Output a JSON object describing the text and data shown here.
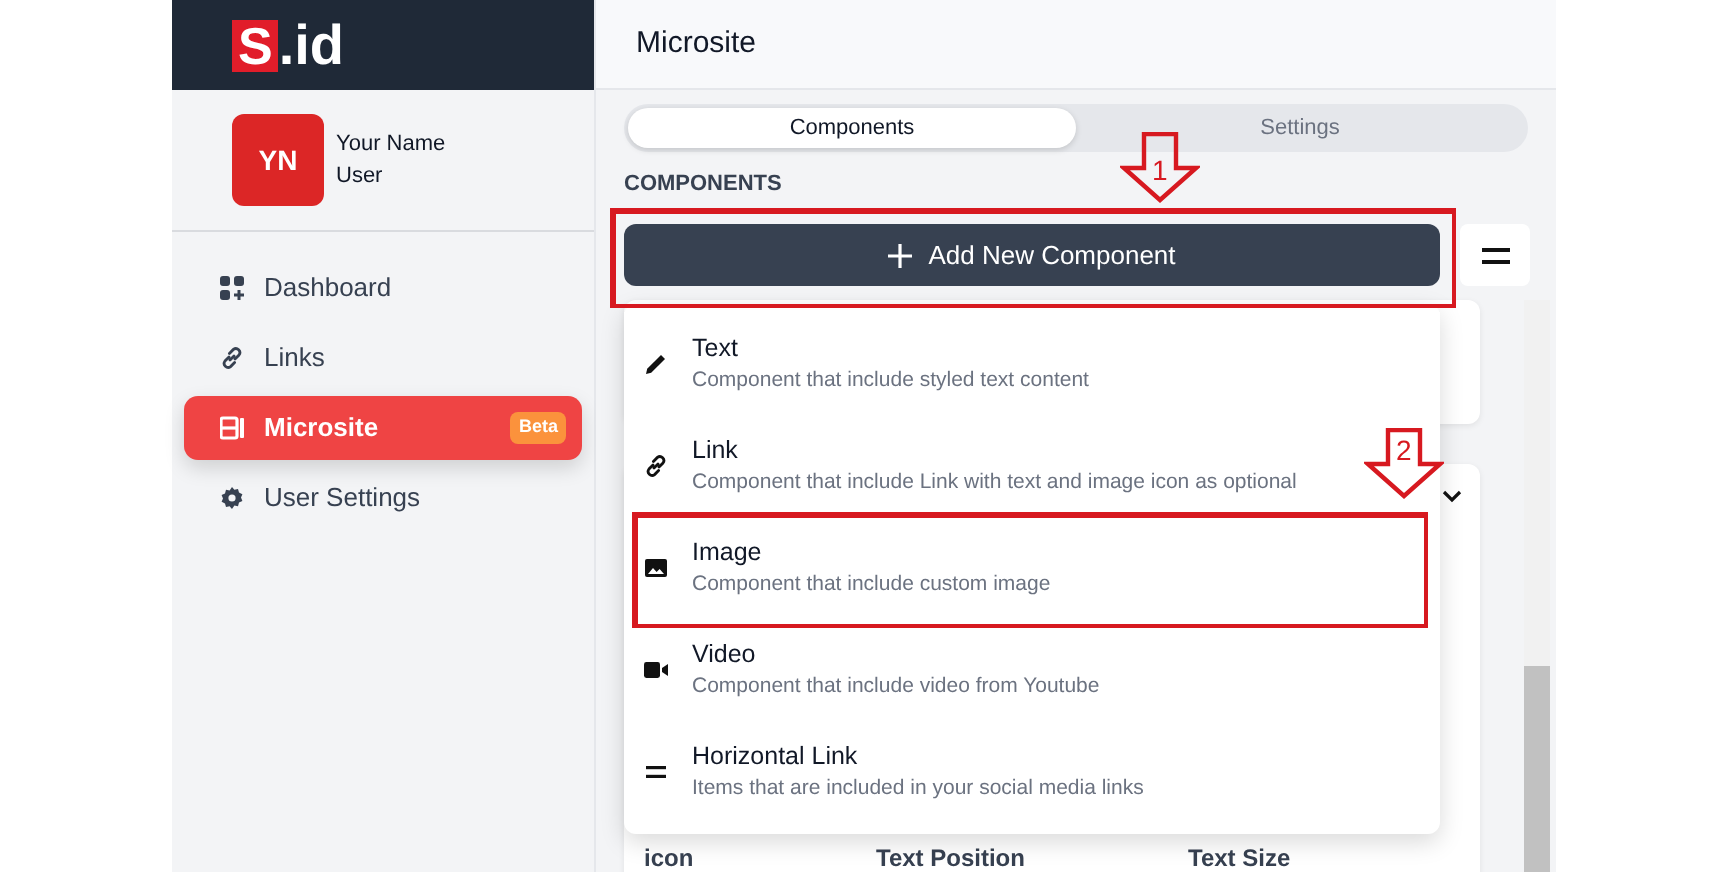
{
  "logo": {
    "mark": "S",
    "rest": ".id"
  },
  "user": {
    "initials": "YN",
    "name": "Your Name",
    "role": "User"
  },
  "nav": [
    {
      "kind": "dashboard",
      "label": "Dashboard",
      "selected": false
    },
    {
      "kind": "link",
      "label": "Links",
      "selected": false
    },
    {
      "kind": "microsite",
      "label": "Microsite",
      "selected": true,
      "badge": "Beta"
    },
    {
      "kind": "gear",
      "label": "User Settings",
      "selected": false
    }
  ],
  "header": {
    "title": "Microsite"
  },
  "tabs": [
    {
      "label": "Components",
      "selected": true
    },
    {
      "label": "Settings",
      "selected": false
    }
  ],
  "section_label": "COMPONENTS",
  "add_button": {
    "label": "Add New Component"
  },
  "menu": [
    {
      "kind": "pencil",
      "title": "Text",
      "description": "Component that include styled text content"
    },
    {
      "kind": "link",
      "title": "Link",
      "description": "Component that include Link with text and image icon as optional"
    },
    {
      "kind": "image",
      "title": "Image",
      "description": "Component that include custom image"
    },
    {
      "kind": "video",
      "title": "Video",
      "description": "Component that include video from Youtube"
    },
    {
      "kind": "lines",
      "title": "Horizontal Link",
      "description": "Items that are included in your social media links"
    }
  ],
  "annotations": [
    {
      "number": "1"
    },
    {
      "number": "2"
    }
  ],
  "background_labels": [
    "icon",
    "Text Position",
    "Text Size"
  ]
}
